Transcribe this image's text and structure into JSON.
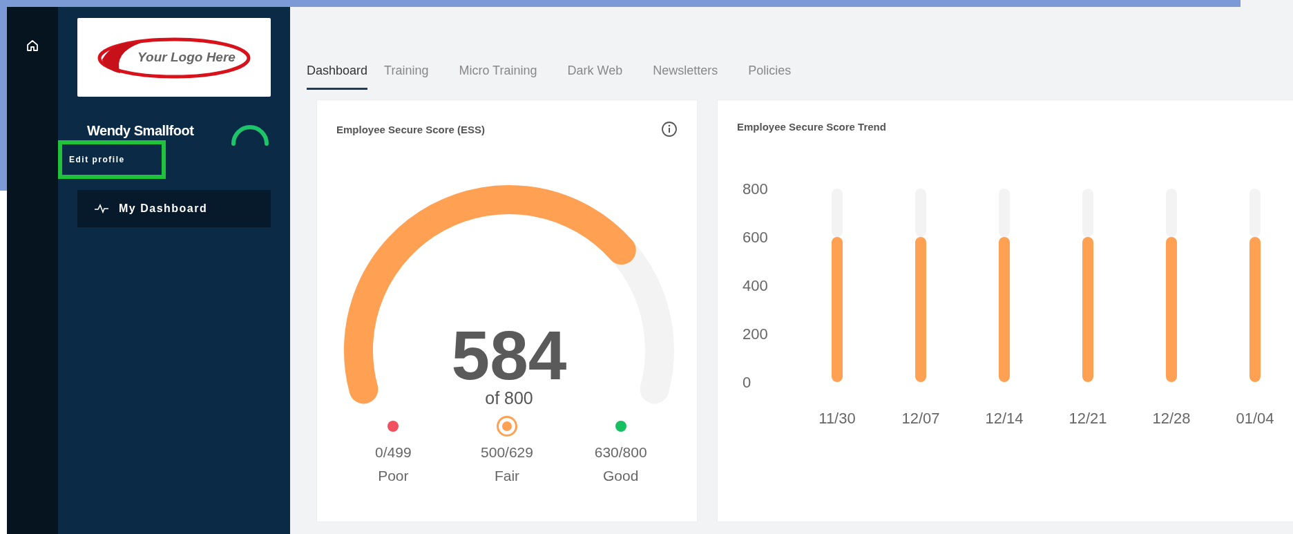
{
  "sidebar": {
    "logo_text": "Your Logo Here",
    "user_name": "Wendy Smallfoot",
    "edit_profile": "Edit profile",
    "nav_items": [
      {
        "label": "My Dashboard"
      }
    ]
  },
  "tabs": [
    {
      "label": "Dashboard",
      "selected": true
    },
    {
      "label": "Training",
      "selected": false
    },
    {
      "label": "Micro Training",
      "selected": false
    },
    {
      "label": "Dark Web",
      "selected": false
    },
    {
      "label": "Newsletters",
      "selected": false
    },
    {
      "label": "Policies",
      "selected": false
    }
  ],
  "score_card": {
    "title": "Employee Secure Score (ESS)",
    "score": "584",
    "out_of": "of 800",
    "ranges": [
      {
        "range": "0/499",
        "label": "Poor",
        "color": "#f0505f",
        "selected": false
      },
      {
        "range": "500/629",
        "label": "Fair",
        "color": "#ffa052",
        "selected": true
      },
      {
        "range": "630/800",
        "label": "Good",
        "color": "#16c060",
        "selected": false
      }
    ]
  },
  "trend_card": {
    "title": "Employee Secure Score Trend",
    "chart_data": {
      "type": "bar",
      "categories": [
        "11/30",
        "12/07",
        "12/14",
        "12/21",
        "12/28",
        "01/04"
      ],
      "series": [
        {
          "color": "#ffa052",
          "values": [
            600,
            600,
            600,
            600,
            600,
            600
          ]
        },
        {
          "color": "#f3f3f3",
          "values": [
            200,
            200,
            200,
            200,
            200,
            200
          ]
        }
      ],
      "stacked": true,
      "ylim": [
        0,
        800
      ],
      "yticks": [
        0,
        200,
        400,
        600,
        800
      ]
    }
  }
}
